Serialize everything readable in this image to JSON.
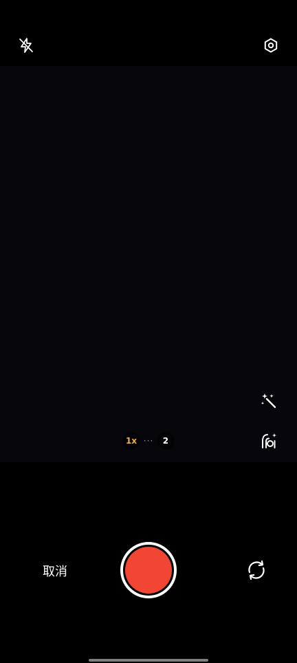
{
  "top_bar": {
    "flash_icon": "flash-off-icon",
    "settings_icon": "settings-icon"
  },
  "viewfinder": {
    "side_tools": [
      {
        "icon": "magic-wand-icon"
      },
      {
        "icon": "portrait-mode-icon"
      }
    ]
  },
  "zoom": {
    "options": [
      "1x",
      "···",
      "2"
    ],
    "active": "1x",
    "active_color": "#e7b24a"
  },
  "bottom_bar": {
    "cancel_label": "取消",
    "record_color": "#f24634",
    "switch_icon": "switch-camera-icon"
  }
}
